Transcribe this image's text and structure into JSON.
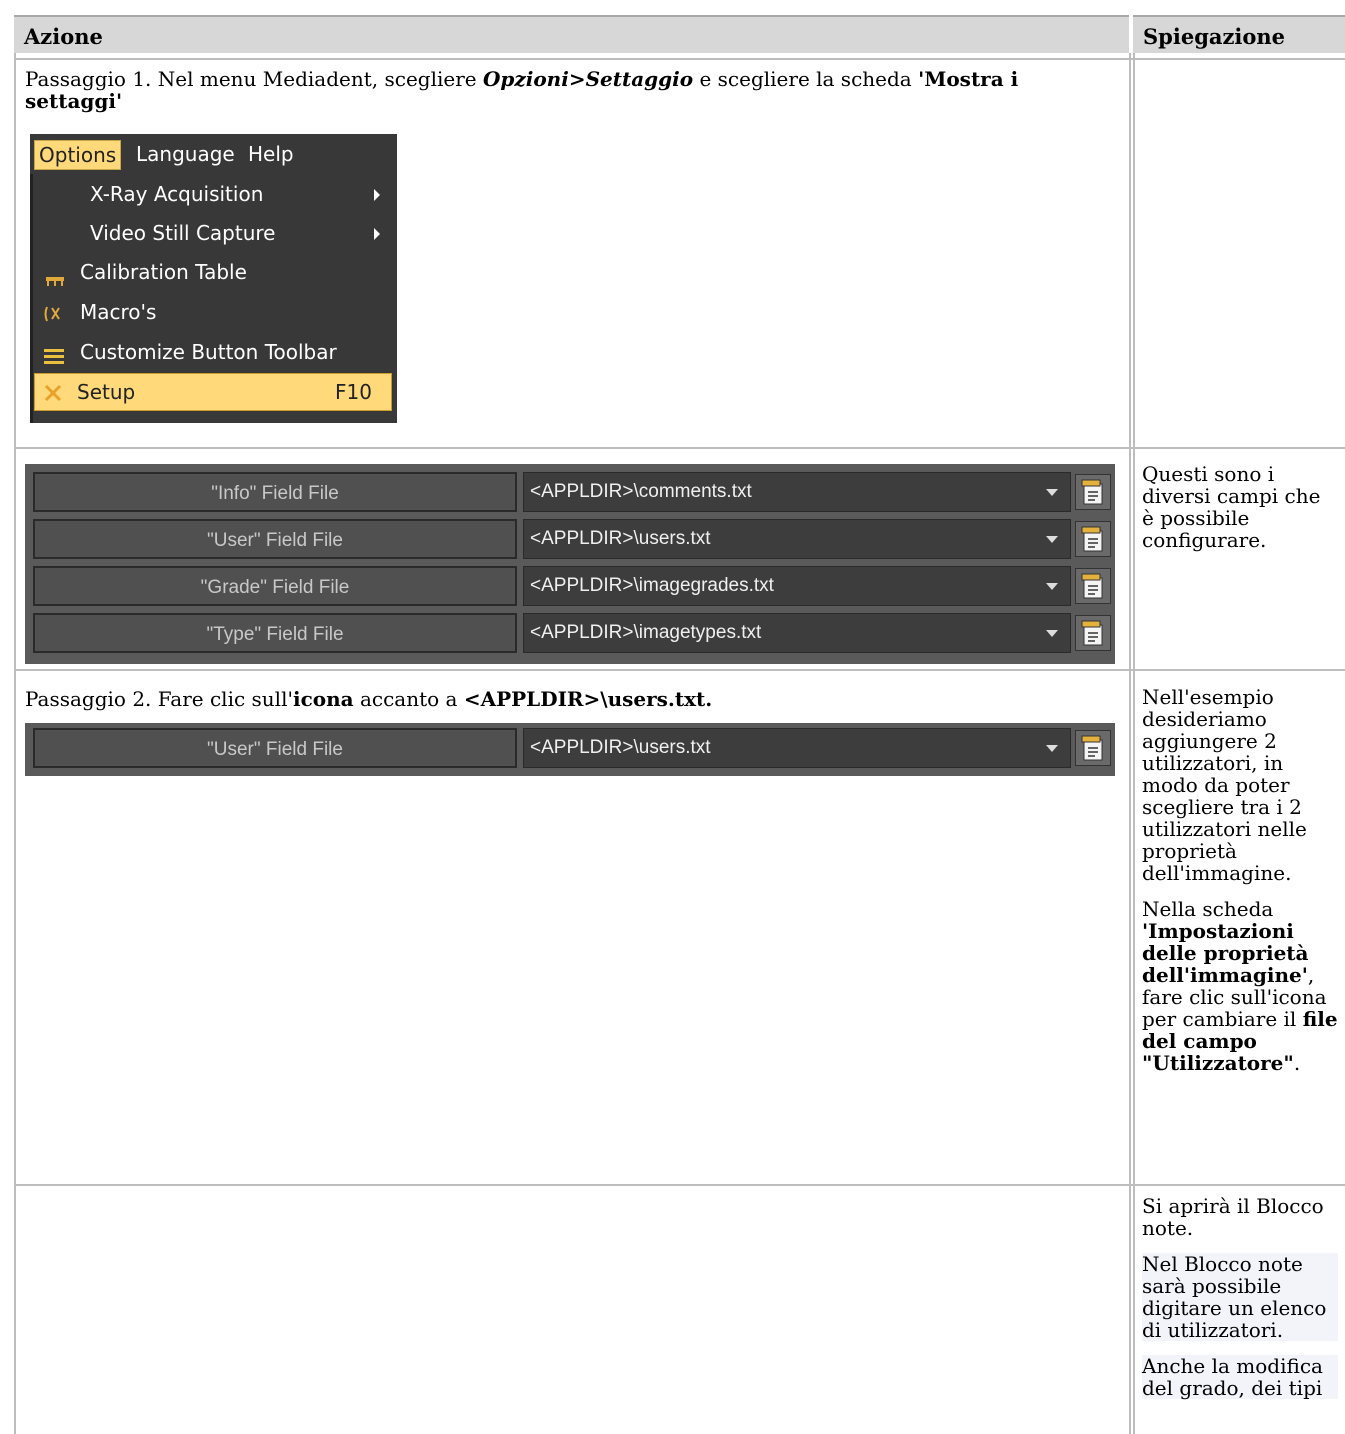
{
  "table": {
    "col_action": "Azione",
    "col_explain": "Spiegazione"
  },
  "row1": {
    "step_prefix": "Passaggio 1. Nel menu Mediadent, scegliere ",
    "step_menu": "Opzioni>Settaggio",
    "step_mid": " e scegliere la scheda ",
    "step_tab": "'Mostra i settaggi'"
  },
  "menu": {
    "bar": [
      "Options",
      "Language",
      "Help"
    ],
    "items": [
      {
        "label": "X-Ray Acquisition",
        "icon": "none",
        "submenu": true
      },
      {
        "label": "Video Still Capture",
        "icon": "none",
        "submenu": true
      },
      {
        "label": "Calibration Table",
        "icon": "ruler-icon",
        "submenu": false
      },
      {
        "label": "Macro's",
        "icon": "macro-icon",
        "submenu": false
      },
      {
        "label": "Customize Button Toolbar",
        "icon": "toolbar-icon",
        "submenu": false
      },
      {
        "label": "Setup",
        "icon": "tools-icon",
        "shortcut": "F10",
        "selected": true
      }
    ]
  },
  "fields": [
    {
      "label": "\"Info\" Field File",
      "value": "<APPLDIR>\\comments.txt"
    },
    {
      "label": "\"User\" Field File",
      "value": "<APPLDIR>\\users.txt"
    },
    {
      "label": "\"Grade\" Field File",
      "value": "<APPLDIR>\\imagegrades.txt"
    },
    {
      "label": "\"Type\" Field File",
      "value": "<APPLDIR>\\imagetypes.txt"
    }
  ],
  "row2_explain": "Questi sono i diversi campi che è possibile configurare.",
  "row3": {
    "step_prefix": "Passaggio 2. Fare clic sull'",
    "step_icon": "icona",
    "step_mid": " accanto a ",
    "step_path": "<APPLDIR>\\users.txt.",
    "field_label": "\"User\" Field File",
    "field_value": "<APPLDIR>\\users.txt",
    "explain1": "Nell'esempio desideriamo aggiungere 2 utilizzatori, in modo da poter scegliere tra i 2 utilizzatori nelle proprietà dell'immagine.",
    "explain2_a": "Nella scheda ",
    "explain2_b": "'Impostazioni delle proprietà dell'immagine'",
    "explain2_c": ", fare clic sull'icona per cambiare il ",
    "explain2_d": "file del campo \"Utilizzatore\"",
    "explain2_e": "."
  },
  "row4": {
    "p1": "Si aprirà il Blocco note.",
    "p2": "Nel Blocco note sarà possibile digitare un elenco di utilizzatori.",
    "p3": "Anche la modifica del grado, dei tipi"
  }
}
